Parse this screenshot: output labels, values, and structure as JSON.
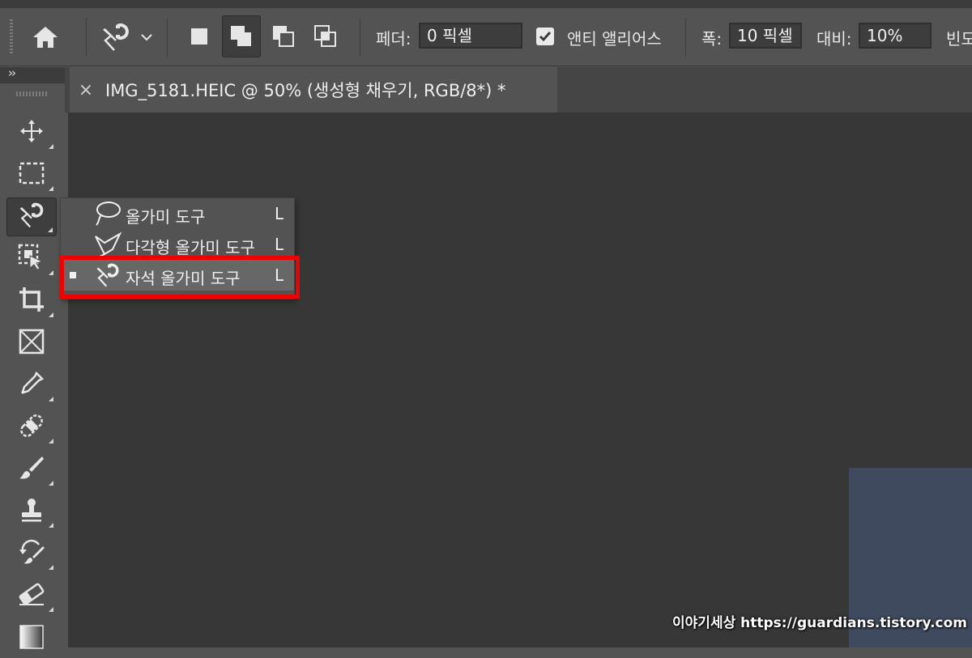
{
  "options_bar": {
    "feather_label": "페더:",
    "feather_value": "0 픽셀",
    "antialias_label": "앤티 앨리어스",
    "antialias_checked": true,
    "width_label": "폭:",
    "width_value": "10 픽셀",
    "contrast_label": "대비:",
    "contrast_value": "10%",
    "frequency_label": "빈도"
  },
  "document": {
    "tab_title": "IMG_5181.HEIC @ 50% (생성형 채우기, RGB/8*) *",
    "close_glyph": "×"
  },
  "toolbar": {
    "collapse_glyph": "››"
  },
  "flyout": {
    "items": [
      {
        "label": "올가미 도구",
        "shortcut": "L",
        "icon": "lasso-icon"
      },
      {
        "label": "다각형 올가미 도구",
        "shortcut": "L",
        "icon": "polygonal-lasso-icon"
      },
      {
        "label": "자석 올가미 도구",
        "shortcut": "L",
        "icon": "magnetic-lasso-icon",
        "selected": true
      }
    ]
  },
  "watermark": "이야기세상 https://guardians.tistory.com",
  "colors": {
    "highlight": "#f10000",
    "canvas": "#373737",
    "panel": "#535353"
  }
}
